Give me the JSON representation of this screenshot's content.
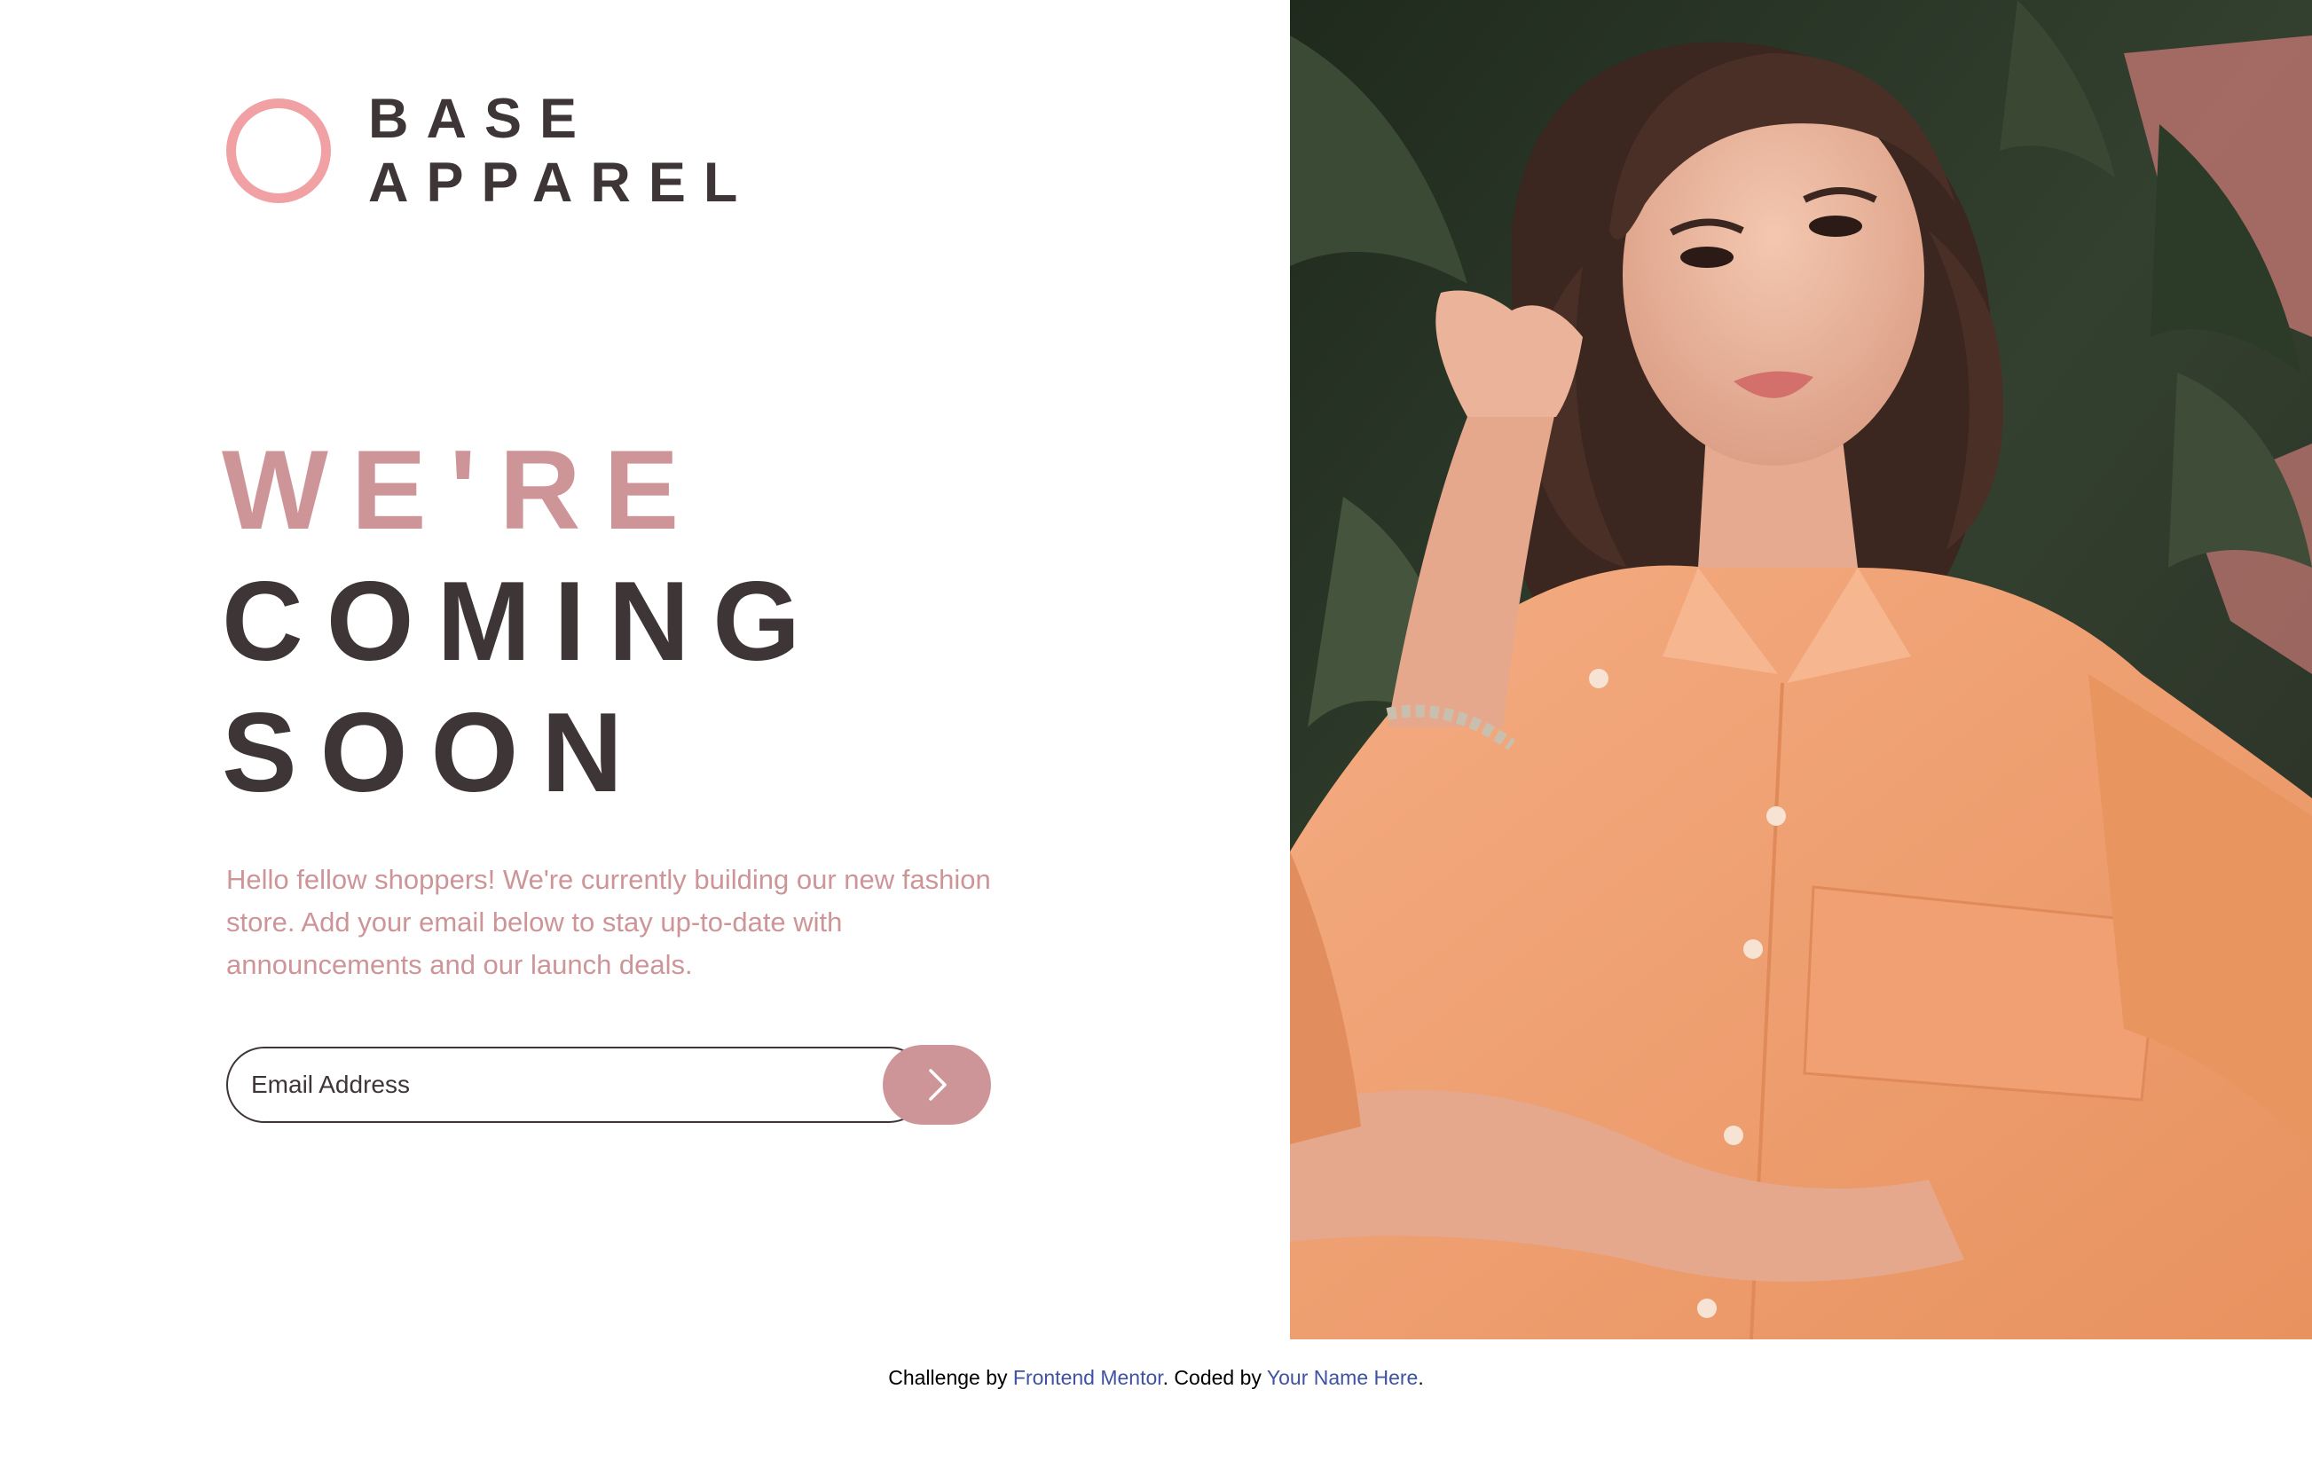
{
  "brand": {
    "line1": "BASE",
    "line2": "APPAREL",
    "ring_color": "#f1a1a3"
  },
  "headline": {
    "accent": "WE'RE",
    "line2": "COMING",
    "line3": "SOON"
  },
  "intro": "Hello fellow shoppers! We're currently building our new fashion store. Add your email below to stay up-to-date with announcements and our launch deals.",
  "signup": {
    "placeholder": "Email Address",
    "submit_icon": "chevron-right-icon"
  },
  "hero": {
    "alt": "Woman in an orange button-up shirt posing in front of tropical plants"
  },
  "footer": {
    "prefix": "Challenge by",
    "link1": "Frontend Mentor",
    "middle": ". Coded by",
    "link2": "Your Name Here",
    "suffix": "."
  },
  "colors": {
    "accent": "#ce9598",
    "dark": "#3e3537",
    "link": "#3e52a3",
    "shirt": "#f0a276"
  }
}
